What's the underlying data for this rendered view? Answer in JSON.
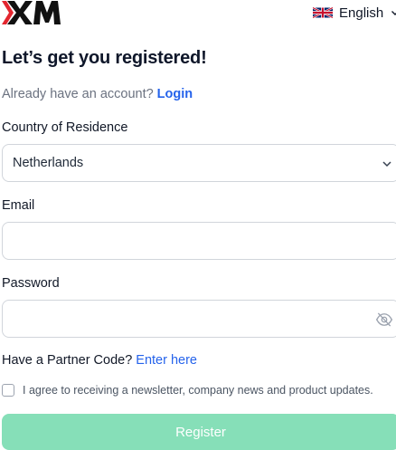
{
  "header": {
    "logo_text": "XM",
    "language": {
      "label": "English",
      "flag_icon": "uk-flag-icon",
      "chevron_icon": "chevron-down-icon"
    }
  },
  "form": {
    "title": "Let’s get you registered!",
    "login_prompt": "Already have an account?",
    "login_link": "Login",
    "country": {
      "label": "Country of Residence",
      "value": "Netherlands",
      "icon": "chevron-down-icon"
    },
    "email": {
      "label": "Email",
      "value": "",
      "placeholder": ""
    },
    "password": {
      "label": "Password",
      "value": "",
      "placeholder": "",
      "icon": "eye-off-icon"
    },
    "partner_prompt": "Have a Partner Code?",
    "partner_link": "Enter here",
    "consent": {
      "label": "I agree to receiving a newsletter, company news and product updates.",
      "checked": false
    },
    "register_button": "Register"
  },
  "colors": {
    "brand_red": "#e3262f",
    "link_blue": "#2563eb",
    "register_button_bg": "#86dfb8"
  }
}
